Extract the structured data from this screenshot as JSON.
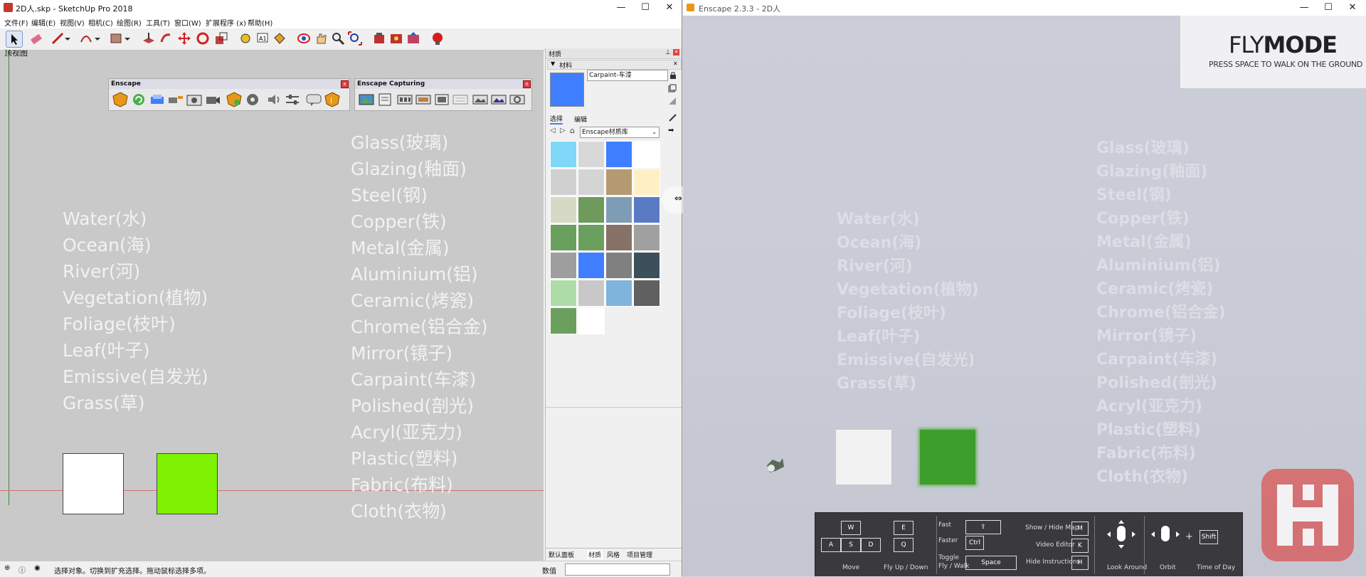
{
  "sketchup": {
    "title": "2D人.skp - SketchUp Pro 2018",
    "window_controls": {
      "minimize": "—",
      "maximize": "☐",
      "close": "✕"
    },
    "menu": [
      "文件(F)",
      "编辑(E)",
      "视图(V)",
      "相机(C)",
      "绘图(R)",
      "工具(T)",
      "窗口(W)",
      "扩展程序 (x)",
      "帮助(H)"
    ],
    "view_label": "顶视图",
    "enscape_toolbar": {
      "title": "Enscape",
      "close": "x"
    },
    "capture_toolbar": {
      "title": "Enscape Capturing",
      "close": "x"
    },
    "left_labels": [
      "Water(水)",
      "Ocean(海)",
      "River(河)",
      "Vegetation(植物)",
      "Foliage(枝叶)",
      "Leaf(叶子)",
      "Emissive(自发光)",
      "Grass(草)"
    ],
    "right_labels": [
      "Glass(玻璃)",
      "Glazing(釉面)",
      "Steel(钢)",
      "Copper(铁)",
      "Metal(金属)",
      "Aluminium(铝)",
      "Ceramic(烤瓷)",
      "Chrome(铝合金)",
      "Mirror(镜子)",
      "Carpaint(车漆)",
      "Polished(剖光)",
      "Acryl(亚克力)",
      "Plastic(塑料)",
      "Fabric(布料)",
      "Cloth(衣物)"
    ],
    "materials_panel": {
      "title": "材质",
      "section": "材料",
      "material_name": "Carpaint-车漆",
      "selected_color": "#3f7fff",
      "tab_select": "选择",
      "tab_edit": "编辑",
      "library": "Enscape材质库",
      "swatches": [
        "#7fd8f8",
        "#d8d8d8",
        "#3f7fff",
        "#ffffff",
        "#d0d0d0",
        "#d4d4d4",
        "#b49a72",
        "#fdf0c4",
        "#d6d9c4",
        "#6e9a5c",
        "#7f9cb6",
        "#5a7bc4",
        "#6b9f5d",
        "#6b9f5d",
        "#877268",
        "#a0a0a0",
        "#9e9e9e",
        "#3f7fff",
        "#808080",
        "#3e4f5c",
        "#aedca8",
        "#c8c8c8",
        "#7fb4dc",
        "#606060",
        "#6b9f5d",
        "#ffffff"
      ],
      "bottom_tabs": [
        "默认面板",
        "材质",
        "风格",
        "项目管理"
      ]
    },
    "status_text": "选择对象。切换到扩充选择。拖动鼠标选择多项。",
    "measurement_label": "数值"
  },
  "enscape": {
    "title": "Enscape 2.3.3 - 2D人",
    "window_controls": {
      "minimize": "—",
      "maximize": "☐",
      "close": "✕"
    },
    "flymode": {
      "fly": "FLY",
      "mode": "MODE",
      "hint": "PRESS SPACE TO WALK ON THE GROUND"
    },
    "left_labels": [
      "Water(水)",
      "Ocean(海)",
      "River(河)",
      "Vegetation(植物)",
      "Foliage(枝叶)",
      "Leaf(叶子)",
      "Emissive(自发光)",
      "Grass(草)"
    ],
    "right_labels": [
      "Glass(玻璃)",
      "Glazing(釉面)",
      "Steel(钢)",
      "Copper(铁)",
      "Metal(金属)",
      "Aluminium(铝)",
      "Ceramic(烤瓷)",
      "Chrome(铝合金)",
      "Mirror(镜子)",
      "Carpaint(车漆)",
      "Polished(剖光)",
      "Acryl(亚克力)",
      "Plastic(塑料)",
      "Fabric(布料)",
      "Cloth(衣物)"
    ],
    "controls": {
      "keys_move": [
        "W",
        "A",
        "S",
        "D"
      ],
      "keys_updown": [
        "E",
        "Q"
      ],
      "move": "Move",
      "fly_updown": "Fly Up / Down",
      "fast": "Fast",
      "faster": "Faster",
      "ctrl": "Ctrl",
      "toggle": "Toggle",
      "fly_walk": "Fly / Walk",
      "space": "Space",
      "show_hide_map": "Show / Hide Map",
      "video_editor": "Video Editor",
      "hide_instructions": "Hide Instructions",
      "key_m": "M",
      "key_k": "K",
      "key_h": "H",
      "look_around": "Look Around",
      "orbit": "Orbit",
      "plus": "+",
      "shift": "Shift",
      "time_of_day": "Time of Day"
    }
  }
}
